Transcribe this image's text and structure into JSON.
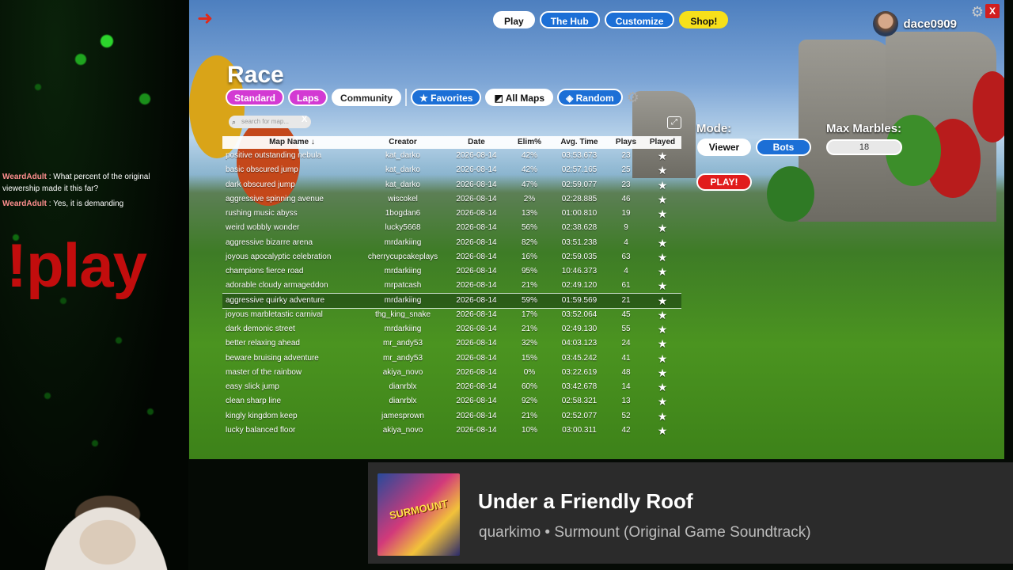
{
  "chat": [
    {
      "user": "WeardAdult",
      "text": ": What percent of the original viewership made it this far?"
    },
    {
      "user": "WeardAdult",
      "text": ": Yes, it is demanding"
    }
  ],
  "overlay_command": "!play",
  "game": {
    "nav": {
      "play": "Play",
      "hub": "The Hub",
      "customize": "Customize",
      "shop": "Shop!"
    },
    "username": "dace0909",
    "close_label": "X",
    "title": "Race",
    "filters": {
      "standard": "Standard",
      "laps": "Laps",
      "community": "Community",
      "favorites": "Favorites",
      "all_maps": "All Maps",
      "random": "Random"
    },
    "search": {
      "placeholder": "search for map...",
      "clear": "X"
    },
    "table": {
      "headers": {
        "name": "Map Name ↓",
        "creator": "Creator",
        "date": "Date",
        "elim": "Elim%",
        "time": "Avg. Time",
        "plays": "Plays",
        "played": "Played"
      },
      "rows": [
        {
          "name": "positive outstanding nebula",
          "creator": "kat_darko",
          "date": "2026-08-14",
          "elim": "42%",
          "time": "03:53.673",
          "plays": "23"
        },
        {
          "name": "basic obscured jump",
          "creator": "kat_darko",
          "date": "2026-08-14",
          "elim": "42%",
          "time": "02:57.165",
          "plays": "25"
        },
        {
          "name": "dark obscured jump",
          "creator": "kat_darko",
          "date": "2026-08-14",
          "elim": "47%",
          "time": "02:59.077",
          "plays": "23"
        },
        {
          "name": "aggressive spinning avenue",
          "creator": "wiscokel",
          "date": "2026-08-14",
          "elim": "2%",
          "time": "02:28.885",
          "plays": "46"
        },
        {
          "name": "rushing music abyss",
          "creator": "1bogdan6",
          "date": "2026-08-14",
          "elim": "13%",
          "time": "01:00.810",
          "plays": "19"
        },
        {
          "name": "weird wobbly wonder",
          "creator": "lucky5668",
          "date": "2026-08-14",
          "elim": "56%",
          "time": "02:38.628",
          "plays": "9"
        },
        {
          "name": "aggressive bizarre arena",
          "creator": "mrdarkiing",
          "date": "2026-08-14",
          "elim": "82%",
          "time": "03:51.238",
          "plays": "4"
        },
        {
          "name": "joyous apocalyptic celebration",
          "creator": "cherrycupcakeplays",
          "date": "2026-08-14",
          "elim": "16%",
          "time": "02:59.035",
          "plays": "63"
        },
        {
          "name": "champions fierce road",
          "creator": "mrdarkiing",
          "date": "2026-08-14",
          "elim": "95%",
          "time": "10:46.373",
          "plays": "4"
        },
        {
          "name": "adorable cloudy armageddon",
          "creator": "mrpatcash",
          "date": "2026-08-14",
          "elim": "21%",
          "time": "02:49.120",
          "plays": "61"
        },
        {
          "name": "aggressive quirky adventure",
          "creator": "mrdarkiing",
          "date": "2026-08-14",
          "elim": "59%",
          "time": "01:59.569",
          "plays": "21"
        },
        {
          "name": "joyous marbletastic carnival",
          "creator": "thg_king_snake",
          "date": "2026-08-14",
          "elim": "17%",
          "time": "03:52.064",
          "plays": "45"
        },
        {
          "name": "dark demonic street",
          "creator": "mrdarkiing",
          "date": "2026-08-14",
          "elim": "21%",
          "time": "02:49.130",
          "plays": "55"
        },
        {
          "name": "better relaxing ahead",
          "creator": "mr_andy53",
          "date": "2026-08-14",
          "elim": "32%",
          "time": "04:03.123",
          "plays": "24"
        },
        {
          "name": "beware bruising adventure",
          "creator": "mr_andy53",
          "date": "2026-08-14",
          "elim": "15%",
          "time": "03:45.242",
          "plays": "41"
        },
        {
          "name": "master of the rainbow",
          "creator": "akiya_novo",
          "date": "2026-08-14",
          "elim": "0%",
          "time": "03:22.619",
          "plays": "48"
        },
        {
          "name": "easy slick jump",
          "creator": "dianrblx",
          "date": "2026-08-14",
          "elim": "60%",
          "time": "03:42.678",
          "plays": "14"
        },
        {
          "name": "clean sharp line",
          "creator": "dianrblx",
          "date": "2026-08-14",
          "elim": "92%",
          "time": "02:58.321",
          "plays": "13"
        },
        {
          "name": "kingly kingdom keep",
          "creator": "jamesprown",
          "date": "2026-08-14",
          "elim": "21%",
          "time": "02:52.077",
          "plays": "52"
        },
        {
          "name": "lucky balanced floor",
          "creator": "akiya_novo",
          "date": "2026-08-14",
          "elim": "10%",
          "time": "03:00.311",
          "plays": "42"
        }
      ],
      "highlighted_index": 10
    },
    "mode_label": "Mode:",
    "mode_viewer": "Viewer",
    "mode_bots": "Bots",
    "max_marbles_label": "Max Marbles:",
    "max_marbles_value": "18",
    "play_button": "PLAY!"
  },
  "now_playing": {
    "title": "Under a Friendly Roof",
    "subtitle": "quarkimo • Surmount (Original Game Soundtrack)",
    "art_text": "SURMOUNT"
  },
  "colors": {
    "accent_blue": "#1c6fd6",
    "accent_pink": "#d33ad3",
    "shop_yellow": "#f7e01a",
    "play_red": "#e11c1c"
  }
}
